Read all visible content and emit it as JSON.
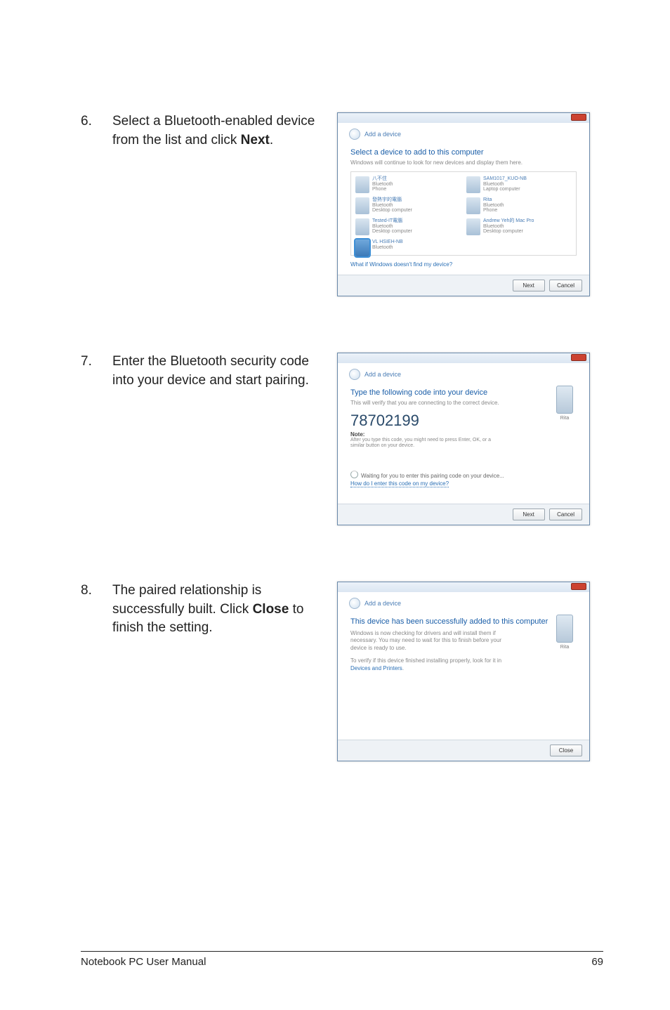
{
  "steps": [
    {
      "num": "6.",
      "text_plain_before": "Select a Bluetooth-enabled device from the list and click ",
      "text_bold": "Next",
      "text_plain_after": "."
    },
    {
      "num": "7.",
      "text_plain_before": "Enter the Bluetooth security code into your device and start pairing.",
      "text_bold": "",
      "text_plain_after": ""
    },
    {
      "num": "8.",
      "text_plain_before": "The paired relationship is successfully built. Click ",
      "text_bold": "Close",
      "text_plain_after": " to finish the setting."
    }
  ],
  "dialog1": {
    "breadcrumb": "Add a device",
    "title": "Select a device to add to this computer",
    "subtitle": "Windows will continue to look for new devices and display them here.",
    "devices": [
      {
        "name": "八不住",
        "l2": "Bluetooth",
        "l3": "Phone"
      },
      {
        "name": "SAM1017_KUO-NB",
        "l2": "Bluetooth",
        "l3": "Laptop computer"
      },
      {
        "name": "發熱宇的電腦",
        "l2": "Bluetooth",
        "l3": "Desktop computer"
      },
      {
        "name": "Rita",
        "l2": "Bluetooth",
        "l3": "Phone"
      },
      {
        "name": "Tested-IT電腦",
        "l2": "Bluetooth",
        "l3": "Desktop computer"
      },
      {
        "name": "Andrew Yeh的 Mac Pro",
        "l2": "Bluetooth",
        "l3": "Desktop computer"
      },
      {
        "name": "VL HSIEH-NB",
        "l2": "Bluetooth",
        "l3": ""
      }
    ],
    "help_link": "What if Windows doesn't find my device?",
    "buttons": {
      "next": "Next",
      "cancel": "Cancel"
    }
  },
  "dialog2": {
    "breadcrumb": "Add a device",
    "title": "Type the following code into your device",
    "subtitle": "This will verify that you are connecting to the correct device.",
    "code": "78702199",
    "note_label": "Note:",
    "note_text": "After you type this code, you might need to press Enter, OK, or a similar button on your device.",
    "phone_caption": "Rita",
    "waiting": "Waiting for you to enter this pairing code on your device...",
    "help_link": "How do I enter this code on my device?",
    "buttons": {
      "next": "Next",
      "cancel": "Cancel"
    }
  },
  "dialog3": {
    "breadcrumb": "Add a device",
    "title": "This device has been successfully added to this computer",
    "para1": "Windows is now checking for drivers and will install them if necessary. You may need to wait for this to finish before your device is ready to use.",
    "para2": "To verify if this device finished installing properly, look for it in ",
    "link": "Devices and Printers",
    "phone_caption": "Rita",
    "buttons": {
      "close": "Close"
    }
  },
  "footer": {
    "left": "Notebook PC User Manual",
    "right": "69"
  }
}
